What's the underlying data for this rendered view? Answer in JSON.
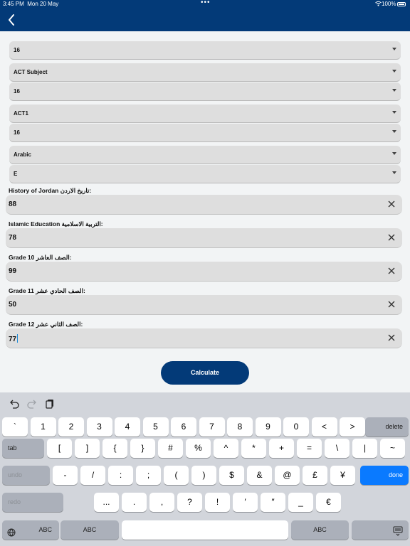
{
  "status_bar": {
    "time": "3:45 PM",
    "date": "Mon 20 May",
    "dots": "•••",
    "battery": "100%"
  },
  "nav": {
    "back_icon": "chevron-left-icon"
  },
  "selects": [
    {
      "value": "16"
    },
    {
      "value": "ACT Subject"
    },
    {
      "value": "16"
    },
    {
      "value": "ACT1"
    },
    {
      "value": "16"
    },
    {
      "value": "Arabic"
    },
    {
      "value": "E"
    }
  ],
  "fields": [
    {
      "label": "History of Jordan تاريخ الاردن:",
      "value": "88"
    },
    {
      "label": "Islamic Education التربية الاسلامية:",
      "value": "78"
    },
    {
      "label": "Grade 10 الصف العاشر:",
      "value": "99"
    },
    {
      "label": "Grade 11 الصف الحادي عشر:",
      "value": "50"
    },
    {
      "label": "Grade 12 الصف الثاني عشر:",
      "value": "77"
    }
  ],
  "calculate_label": "Calculate",
  "keyboard": {
    "row1": [
      "`",
      "1",
      "2",
      "3",
      "4",
      "5",
      "6",
      "7",
      "8",
      "9",
      "0",
      "<",
      ">"
    ],
    "delete": "delete",
    "tab": "tab",
    "row2": [
      "[",
      "]",
      "{",
      "}",
      "#",
      "%",
      "^",
      "*",
      "+",
      "=",
      "\\",
      "|",
      "~"
    ],
    "undo": "undo",
    "row3": [
      "-",
      "/",
      ":",
      ";",
      "(",
      ")",
      "$",
      "&",
      "@",
      "£",
      "¥"
    ],
    "done": "done",
    "redo": "redo",
    "row4": [
      "...",
      ".",
      ",",
      "?",
      "!",
      "′",
      "″",
      "_",
      "€"
    ],
    "abc_left": "ABC",
    "abc_right": "ABC"
  },
  "accent_color": "#033a78",
  "done_color": "#0a7aff"
}
